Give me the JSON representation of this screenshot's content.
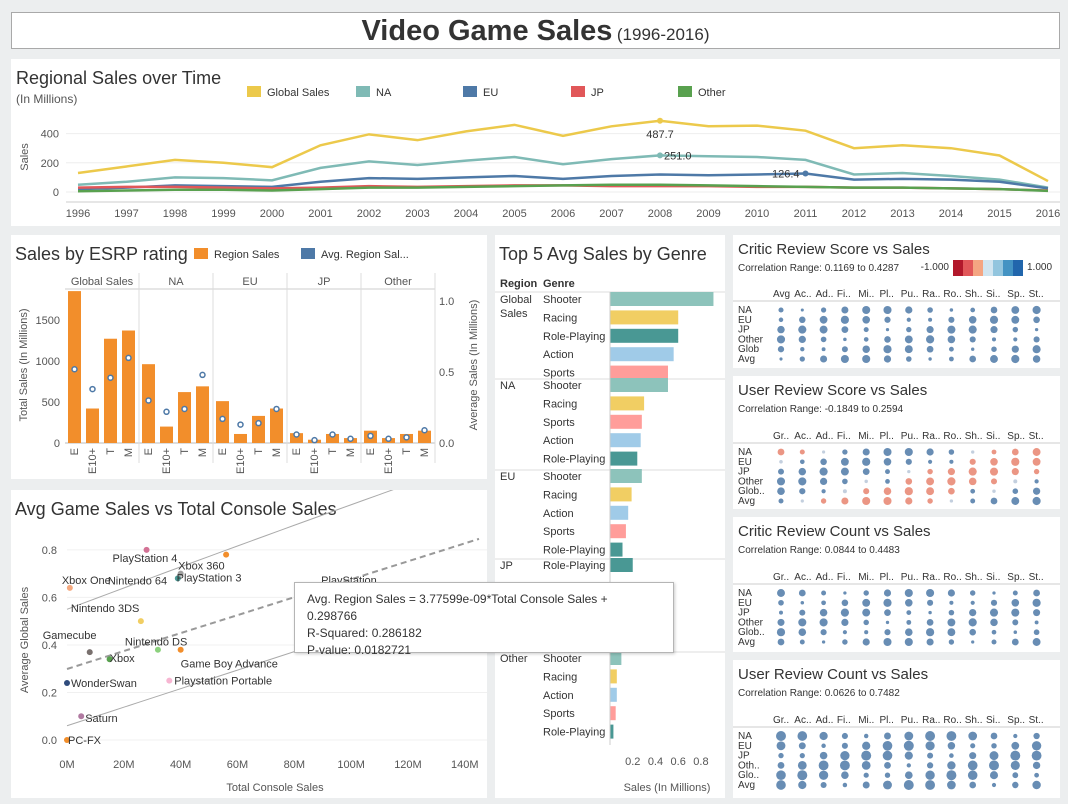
{
  "header": {
    "title": "Video Game Sales",
    "subtitle": "(1996-2016)"
  },
  "regional": {
    "title": "Regional Sales over Time",
    "subtitle": "(In Millions)",
    "ylabel": "Sales",
    "legend": [
      {
        "name": "Global Sales",
        "color": "#ecc94b"
      },
      {
        "name": "NA",
        "color": "#7fbab5"
      },
      {
        "name": "EU",
        "color": "#4e79a7"
      },
      {
        "name": "JP",
        "color": "#e15759"
      },
      {
        "name": "Other",
        "color": "#59a14f"
      }
    ],
    "yticks": [
      "0",
      "200",
      "400"
    ],
    "annotations": {
      "global": "487.7",
      "na": "251.0",
      "eu": "126.4"
    }
  },
  "esrp": {
    "title": "Sales by ESRP rating",
    "legend_bar": "Region Sales",
    "legend_dot": "Avg. Region Sal...",
    "ylabel_left": "Total Sales (In Millions)",
    "ylabel_right": "Average Sales (In Millions)",
    "left_ticks": [
      "0",
      "500",
      "1000",
      "1500"
    ],
    "right_ticks": [
      "0.0",
      "0.5",
      "1.0"
    ]
  },
  "genre": {
    "title": "Top 5 Avg Sales by Genre",
    "col_region": "Region",
    "col_genre": "Genre",
    "xlabel": "Sales (In Millions)",
    "xticks": [
      "0.2",
      "0.4",
      "0.6",
      "0.8"
    ]
  },
  "scatter": {
    "title": "Avg Game Sales vs Total Console Sales",
    "xlabel": "Total Console Sales",
    "ylabel": "Average Global Sales",
    "xticks": [
      "0M",
      "20M",
      "40M",
      "60M",
      "80M",
      "100M",
      "120M",
      "140M"
    ],
    "yticks": [
      "0.0",
      "0.2",
      "0.4",
      "0.6",
      "0.8"
    ],
    "tooltip": {
      "line1": "Avg. Region Sales = 3.77599e-09*Total Console Sales + 0.298766",
      "line2": "R-Squared: 0.286182",
      "line3": "P-value: 0.0182721"
    }
  },
  "heatmaps": [
    {
      "title": "Critic Review Score vs Sales",
      "range": "Correlation Range: 0.1169 to 0.4287",
      "cols": [
        "Avg",
        "Ac..",
        "Ad..",
        "Fi..",
        "Mi..",
        "Pl..",
        "Pu..",
        "Ra..",
        "Ro..",
        "Sh..",
        "Si..",
        "Sp..",
        "St.."
      ],
      "rows": [
        "NA",
        "EU",
        "JP",
        "Other",
        "Glob",
        "Avg"
      ]
    },
    {
      "title": "User Review Score vs Sales",
      "range": "Correlation Range: -0.1849 to 0.2594",
      "cols": [
        "Gr..",
        "Ac..",
        "Ad..",
        "Fi..",
        "Mi..",
        "Pl..",
        "Pu..",
        "Ra..",
        "Ro..",
        "Sh..",
        "Si..",
        "Sp..",
        "St.."
      ],
      "rows": [
        "NA",
        "EU",
        "JP",
        "Other",
        "Glob..",
        "Avg"
      ]
    },
    {
      "title": "Critic Review Count vs Sales",
      "range": "Correlation Range: 0.0844 to 0.4483",
      "cols": [
        "Gr..",
        "Ac..",
        "Ad..",
        "Fi..",
        "Mi..",
        "Pl..",
        "Pu..",
        "Ra..",
        "Ro..",
        "Sh..",
        "Si..",
        "Sp..",
        "St.."
      ],
      "rows": [
        "NA",
        "EU",
        "JP",
        "Other",
        "Glob..",
        "Avg"
      ]
    },
    {
      "title": "User Review Count vs Sales",
      "range": "Correlation Range: 0.0626 to 0.7482",
      "cols": [
        "Gr..",
        "Ac..",
        "Ad..",
        "Fi..",
        "Mi..",
        "Pl..",
        "Pu..",
        "Ra..",
        "Ro..",
        "Sh..",
        "Si..",
        "Sp..",
        "St.."
      ],
      "rows": [
        "NA",
        "EU",
        "JP",
        "Oth..",
        "Glo..",
        "Avg"
      ]
    }
  ],
  "heat_legend": {
    "min": "-1.000",
    "max": "1.000"
  },
  "chart_data": [
    {
      "type": "line",
      "x": [
        1996,
        1997,
        1998,
        1999,
        2000,
        2001,
        2002,
        2003,
        2004,
        2005,
        2006,
        2007,
        2008,
        2009,
        2010,
        2011,
        2012,
        2013,
        2014,
        2015,
        2016
      ],
      "series": [
        {
          "name": "Global Sales",
          "values": [
            130,
            175,
            220,
            200,
            170,
            320,
            395,
            355,
            415,
            460,
            385,
            450,
            487.7,
            450,
            455,
            420,
            300,
            320,
            300,
            250,
            75
          ]
        },
        {
          "name": "NA",
          "values": [
            50,
            70,
            100,
            95,
            80,
            165,
            210,
            185,
            215,
            240,
            190,
            225,
            251.0,
            245,
            240,
            220,
            120,
            130,
            110,
            85,
            30
          ]
        },
        {
          "name": "EU",
          "values": [
            20,
            30,
            45,
            40,
            35,
            70,
            95,
            90,
            100,
            110,
            90,
            110,
            120,
            115,
            120,
            126.4,
            85,
            90,
            85,
            70,
            25
          ]
        },
        {
          "name": "JP",
          "values": [
            30,
            35,
            35,
            30,
            25,
            30,
            40,
            35,
            40,
            45,
            45,
            40,
            40,
            40,
            35,
            35,
            30,
            30,
            25,
            20,
            10
          ]
        },
        {
          "name": "Other",
          "values": [
            5,
            10,
            15,
            15,
            10,
            20,
            30,
            30,
            35,
            40,
            45,
            50,
            50,
            45,
            40,
            35,
            30,
            30,
            25,
            20,
            8
          ]
        }
      ],
      "ylim": [
        0,
        500
      ]
    },
    {
      "type": "bar",
      "groups": [
        "Global Sales",
        "NA",
        "EU",
        "JP",
        "Other"
      ],
      "categories": [
        "E",
        "E10+",
        "T",
        "M"
      ],
      "series": [
        {
          "name": "Region Sales",
          "values": [
            [
              1850,
              420,
              1270,
              1370
            ],
            [
              960,
              200,
              620,
              690
            ],
            [
              510,
              110,
              330,
              420
            ],
            [
              120,
              40,
              110,
              60
            ],
            [
              150,
              60,
              110,
              150
            ]
          ]
        },
        {
          "name": "Avg. Region Sal...",
          "values": [
            [
              0.52,
              0.38,
              0.46,
              0.6
            ],
            [
              0.3,
              0.22,
              0.24,
              0.48
            ],
            [
              0.17,
              0.13,
              0.14,
              0.24
            ],
            [
              0.06,
              0.02,
              0.06,
              0.03
            ],
            [
              0.05,
              0.03,
              0.04,
              0.09
            ]
          ]
        }
      ],
      "ylim": [
        0,
        1900
      ],
      "y2lim": [
        0,
        1.1
      ]
    },
    {
      "type": "bar",
      "orientation": "horizontal",
      "groups": [
        {
          "region": "Global Sales",
          "genres": [
            "Shooter",
            "Racing",
            "Role-Playing",
            "Action",
            "Sports"
          ],
          "values": [
            0.91,
            0.6,
            0.6,
            0.56,
            0.51
          ]
        },
        {
          "region": "NA",
          "genres": [
            "Shooter",
            "Racing",
            "Sports",
            "Action",
            "Role-Playing"
          ],
          "values": [
            0.51,
            0.3,
            0.28,
            0.27,
            0.24
          ]
        },
        {
          "region": "EU",
          "genres": [
            "Shooter",
            "Racing",
            "Action",
            "Sports",
            "Role-Playing"
          ],
          "values": [
            0.28,
            0.19,
            0.16,
            0.14,
            0.11
          ]
        },
        {
          "region": "JP",
          "genres": [
            "Role-Playing"
          ],
          "values": [
            0.2
          ]
        },
        {
          "region": "Other",
          "genres": [
            "Shooter",
            "Racing",
            "Action",
            "Sports",
            "Role-Playing"
          ],
          "values": [
            0.1,
            0.06,
            0.06,
            0.05,
            0.03
          ]
        }
      ],
      "colors": {
        "Shooter": "#8dc3bb",
        "Racing": "#f1ce63",
        "Role-Playing": "#499894",
        "Action": "#a0cbe8",
        "Sports": "#ff9d9a"
      },
      "xlim": [
        0,
        0.95
      ]
    },
    {
      "type": "scatter",
      "points": [
        {
          "label": "PlayStation 4",
          "x": 28,
          "y": 0.8,
          "color": "#d37295"
        },
        {
          "label": "Xbox 360",
          "x": 56,
          "y": 0.78,
          "color": "#f28e2b"
        },
        {
          "label": "Xbox One",
          "x": 1,
          "y": 0.64,
          "color": "#f5a97f"
        },
        {
          "label": "Nintendo 64",
          "x": 39,
          "y": 0.68,
          "color": "#499894"
        },
        {
          "label": "PlayStation 3",
          "x": 40,
          "y": 0.7,
          "color": "#a0a0a0"
        },
        {
          "label": "PlayStation",
          "x": 100,
          "y": 0.64,
          "color": "#f28e2b"
        },
        {
          "label": "Nintendo 3DS",
          "x": 26,
          "y": 0.5,
          "color": "#f1ce63"
        },
        {
          "label": "Gamecube",
          "x": 8,
          "y": 0.37,
          "color": "#79706e"
        },
        {
          "label": "Xbox",
          "x": 15,
          "y": 0.34,
          "color": "#59a14f"
        },
        {
          "label": "Nintendo DS",
          "x": 32,
          "y": 0.38,
          "color": "#8cd17d"
        },
        {
          "label": "Game Boy Advance",
          "x": 40,
          "y": 0.38,
          "color": "#f28e2b"
        },
        {
          "label": "WonderSwan",
          "x": 0,
          "y": 0.24,
          "color": "#2f4b7c"
        },
        {
          "label": "Playstation Portable",
          "x": 36,
          "y": 0.25,
          "color": "#f7b6d2"
        },
        {
          "label": "Saturn",
          "x": 5,
          "y": 0.1,
          "color": "#b07aa1"
        },
        {
          "label": "PC-FX",
          "x": 0,
          "y": 0.0,
          "color": "#f28e2b"
        }
      ],
      "xlim": [
        0,
        145
      ],
      "ylim": [
        0,
        0.85
      ]
    }
  ]
}
